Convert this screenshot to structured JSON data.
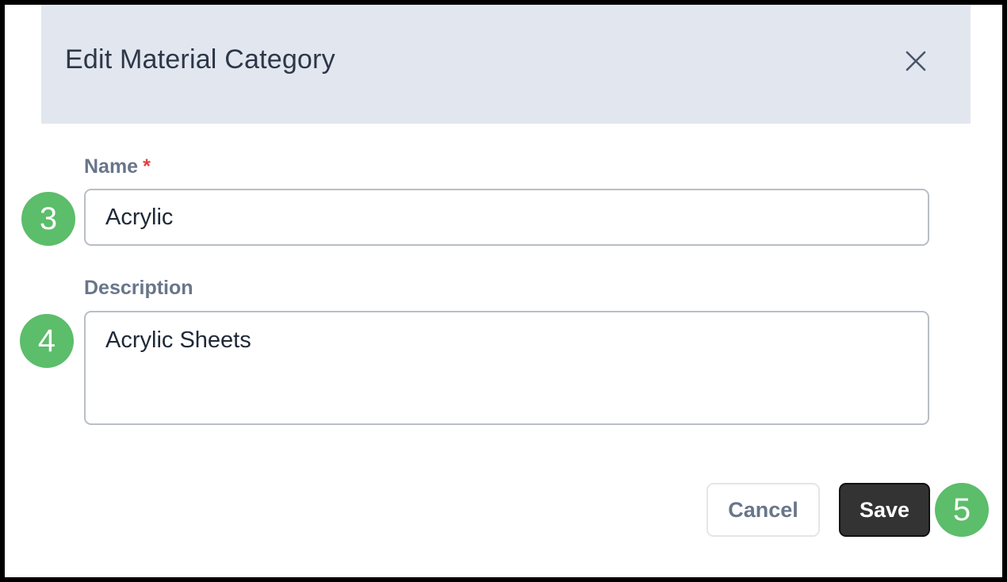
{
  "dialog": {
    "title": "Edit Material Category",
    "close_icon": "close-icon"
  },
  "form": {
    "name": {
      "label": "Name",
      "required_marker": "*",
      "value": "Acrylic"
    },
    "description": {
      "label": "Description",
      "value": "Acrylic Sheets"
    }
  },
  "buttons": {
    "cancel_label": "Cancel",
    "save_label": "Save"
  },
  "annotations": [
    "3",
    "4",
    "5"
  ],
  "colors": {
    "header_bg": "#e2e7ef",
    "badge_green": "#5cbd6a",
    "save_bg": "#333333",
    "required_red": "#e53e3e"
  }
}
